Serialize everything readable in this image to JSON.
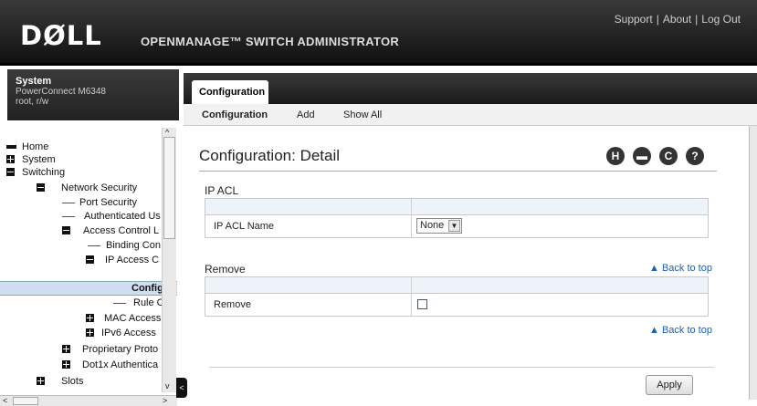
{
  "header": {
    "logo": "DØLL",
    "app_title": "OPENMANAGE™ SWITCH ADMINISTRATOR",
    "links": [
      "Support",
      "About",
      "Log Out"
    ],
    "link_separator": "|"
  },
  "system_box": {
    "title": "System",
    "model": "PowerConnect M6348",
    "user": "root, r/w"
  },
  "tree": [
    {
      "label": "Home",
      "icon": "home-icon"
    },
    {
      "label": "System",
      "icon": "plus-icon"
    },
    {
      "label": "Switching",
      "icon": "minus-icon"
    },
    {
      "label": "Network Security",
      "icon": "minus-icon"
    },
    {
      "label": "Port Security",
      "icon": "leaf"
    },
    {
      "label": "Authenticated Us",
      "icon": "leaf"
    },
    {
      "label": "Access Control L",
      "icon": "minus-icon"
    },
    {
      "label": "Binding Con",
      "icon": "leaf"
    },
    {
      "label": "IP Access C",
      "icon": "minus-icon"
    },
    {
      "label": "Config",
      "icon": "leaf"
    },
    {
      "label": "Rule C",
      "icon": "leaf"
    },
    {
      "label": "MAC Access",
      "icon": "plus-icon"
    },
    {
      "label": "IPv6 Access",
      "icon": "plus-icon"
    },
    {
      "label": "Proprietary Proto",
      "icon": "plus-icon"
    },
    {
      "label": "Dot1x Authentica",
      "icon": "plus-icon"
    },
    {
      "label": "Slots",
      "icon": "plus-icon"
    }
  ],
  "tabs": {
    "main_tab": "Configuration",
    "sub": [
      "Configuration",
      "Add",
      "Show All"
    ]
  },
  "page": {
    "title": "Configuration: Detail",
    "icons": [
      "save-icon",
      "print-icon",
      "refresh-icon",
      "help-icon"
    ],
    "icon_glyphs": [
      "H",
      "▬",
      "C",
      "?"
    ],
    "sections": {
      "ip_acl": {
        "heading": "IP ACL",
        "field_label": "IP ACL Name",
        "select_value": "None",
        "select_arrow": "▼"
      },
      "remove": {
        "heading": "Remove",
        "field_label": "Remove",
        "checked": false
      }
    },
    "back_to_top": "▲ Back to top",
    "apply": "Apply"
  },
  "scroll": {
    "up": "^",
    "down": "v",
    "left": "<",
    "right": ">",
    "collapse": "<"
  }
}
